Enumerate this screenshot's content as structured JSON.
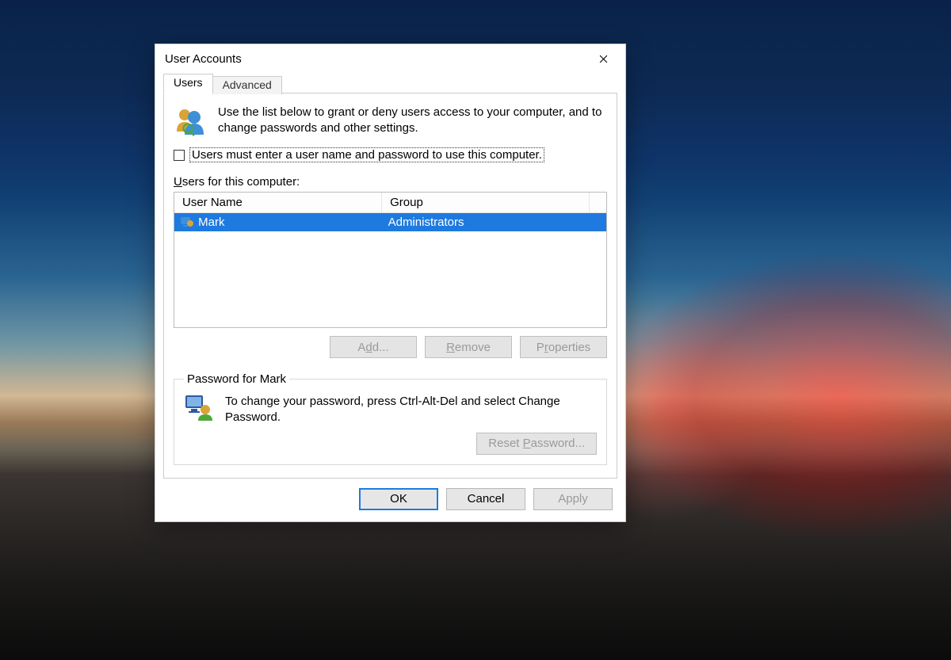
{
  "window": {
    "title": "User Accounts"
  },
  "tabs": {
    "users": "Users",
    "advanced": "Advanced"
  },
  "intro": "Use the list below to grant or deny users access to your computer, and to change passwords and other settings.",
  "checkbox": {
    "label": "Users must enter a user name and password to use this computer.",
    "checked": false
  },
  "listlabel_prefix": "U",
  "listlabel_rest": "sers for this computer:",
  "table": {
    "headers": {
      "username": "User Name",
      "group": "Group"
    },
    "rows": [
      {
        "username": "Mark",
        "group": "Administrators",
        "selected": true
      }
    ]
  },
  "buttons": {
    "add_before": "A",
    "add_ul": "d",
    "add_after": "d...",
    "remove_before": "",
    "remove_ul": "R",
    "remove_after": "emove",
    "props_before": "P",
    "props_ul": "r",
    "props_after": "operties",
    "reset_before": "Reset ",
    "reset_ul": "P",
    "reset_after": "assword...",
    "ok": "OK",
    "cancel": "Cancel",
    "apply_ul": "A",
    "apply_rest": "pply"
  },
  "password_group": {
    "legend": "Password for Mark",
    "text": "To change your password, press Ctrl-Alt-Del and select Change Password."
  }
}
